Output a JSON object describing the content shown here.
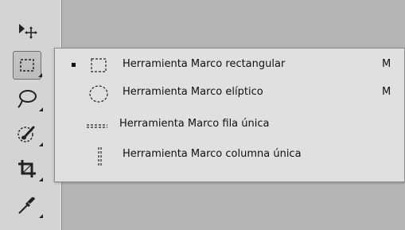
{
  "toolbar": {
    "tools": [
      {
        "name": "move-tool",
        "icon": "move-icon"
      },
      {
        "name": "marquee-tool",
        "icon": "rectangular-marquee-icon",
        "active": true
      },
      {
        "name": "lasso-tool",
        "icon": "lasso-icon"
      },
      {
        "name": "quick-selection-tool",
        "icon": "quick-selection-icon"
      },
      {
        "name": "crop-tool",
        "icon": "crop-icon"
      },
      {
        "name": "eyedropper-tool",
        "icon": "eyedropper-icon"
      }
    ]
  },
  "flyout": {
    "items": [
      {
        "label": "Herramienta Marco rectangular",
        "shortcut": "M",
        "selected": true,
        "icon": "rectangular-marquee-icon"
      },
      {
        "label": "Herramienta Marco elíptico",
        "shortcut": "M",
        "selected": false,
        "icon": "elliptical-marquee-icon"
      },
      {
        "label": "Herramienta Marco fila única",
        "shortcut": "",
        "selected": false,
        "icon": "single-row-marquee-icon"
      },
      {
        "label": "Herramienta Marco columna única",
        "shortcut": "",
        "selected": false,
        "icon": "single-column-marquee-icon"
      }
    ]
  },
  "colors": {
    "toolbar_bg": "#d4d4d4",
    "canvas_bg": "#b4b4b4",
    "menu_bg": "#e0e0e0"
  }
}
